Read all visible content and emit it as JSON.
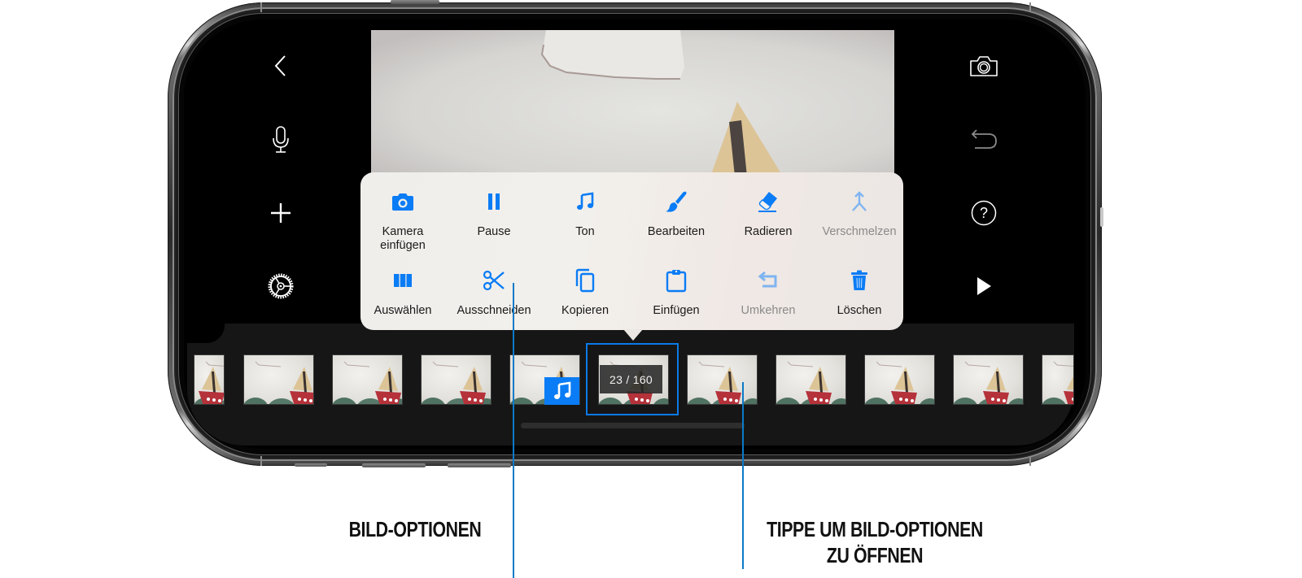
{
  "left_toolbar": {
    "items": [
      {
        "name": "back",
        "icon": "chevron-left-icon"
      },
      {
        "name": "record-audio",
        "icon": "microphone-icon"
      },
      {
        "name": "add",
        "icon": "plus-icon"
      },
      {
        "name": "settings",
        "icon": "gear-icon"
      }
    ]
  },
  "right_toolbar": {
    "items": [
      {
        "name": "camera",
        "icon": "camera-icon"
      },
      {
        "name": "undo",
        "icon": "undo-icon",
        "disabled": true
      },
      {
        "name": "help",
        "icon": "help-icon"
      },
      {
        "name": "play",
        "icon": "play-icon"
      }
    ]
  },
  "frame_options_menu": {
    "items": [
      {
        "label": "Kamera\neinfügen",
        "icon": "camera-fill-icon",
        "enabled": true
      },
      {
        "label": "Pause",
        "icon": "pause-icon",
        "enabled": true
      },
      {
        "label": "Ton",
        "icon": "music-note-icon",
        "enabled": true
      },
      {
        "label": "Bearbeiten",
        "icon": "paintbrush-icon",
        "enabled": true
      },
      {
        "label": "Radieren",
        "icon": "eraser-icon",
        "enabled": true
      },
      {
        "label": "Verschmelzen",
        "icon": "merge-icon",
        "enabled": false
      },
      {
        "label": "Auswählen",
        "icon": "columns-icon",
        "enabled": true
      },
      {
        "label": "Ausschneiden",
        "icon": "scissors-icon",
        "enabled": true
      },
      {
        "label": "Kopieren",
        "icon": "copy-icon",
        "enabled": true
      },
      {
        "label": "Einfügen",
        "icon": "clipboard-icon",
        "enabled": true
      },
      {
        "label": "Umkehren",
        "icon": "reverse-icon",
        "enabled": false
      },
      {
        "label": "Löschen",
        "icon": "trash-icon",
        "enabled": true
      }
    ]
  },
  "filmstrip": {
    "current_frame": 23,
    "total_frames": 160,
    "counter_text": "23 / 160",
    "audio_badge_icon": "music-note-icon"
  },
  "annotations": {
    "left_label": "BILD-OPTIONEN",
    "right_label_line1": "TIPPE UM BILD-OPTIONEN",
    "right_label_line2": "ZU ÖFFNEN"
  },
  "colors": {
    "accent": "#0a7cf5",
    "accent_disabled": "#7fb4f0",
    "callout_line": "#0b7ac8",
    "selection_border": "#0b7ae8"
  }
}
